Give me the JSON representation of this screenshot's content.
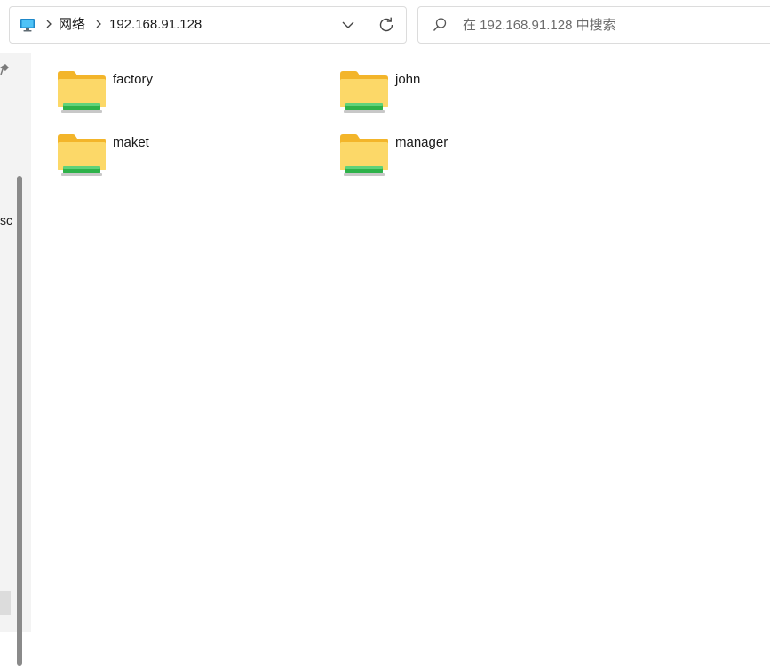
{
  "address_bar": {
    "crumbs": [
      "网络",
      "192.168.91.128"
    ],
    "location_icon": "computer-monitor-icon",
    "dropdown_icon": "chevron-down-icon",
    "refresh_icon": "refresh-icon"
  },
  "search": {
    "placeholder": "在 192.168.91.128 中搜索",
    "icon": "search-icon"
  },
  "nav_pane": {
    "clipped_label": "sc"
  },
  "folders": [
    {
      "name": "factory",
      "icon": "shared-folder-icon"
    },
    {
      "name": "john",
      "icon": "shared-folder-icon"
    },
    {
      "name": "maket",
      "icon": "shared-folder-icon"
    },
    {
      "name": "manager",
      "icon": "shared-folder-icon"
    }
  ],
  "colors": {
    "folder_yellow": "#f8c948",
    "share_green": "#2eb24a",
    "accent": "#1a8ad4"
  }
}
